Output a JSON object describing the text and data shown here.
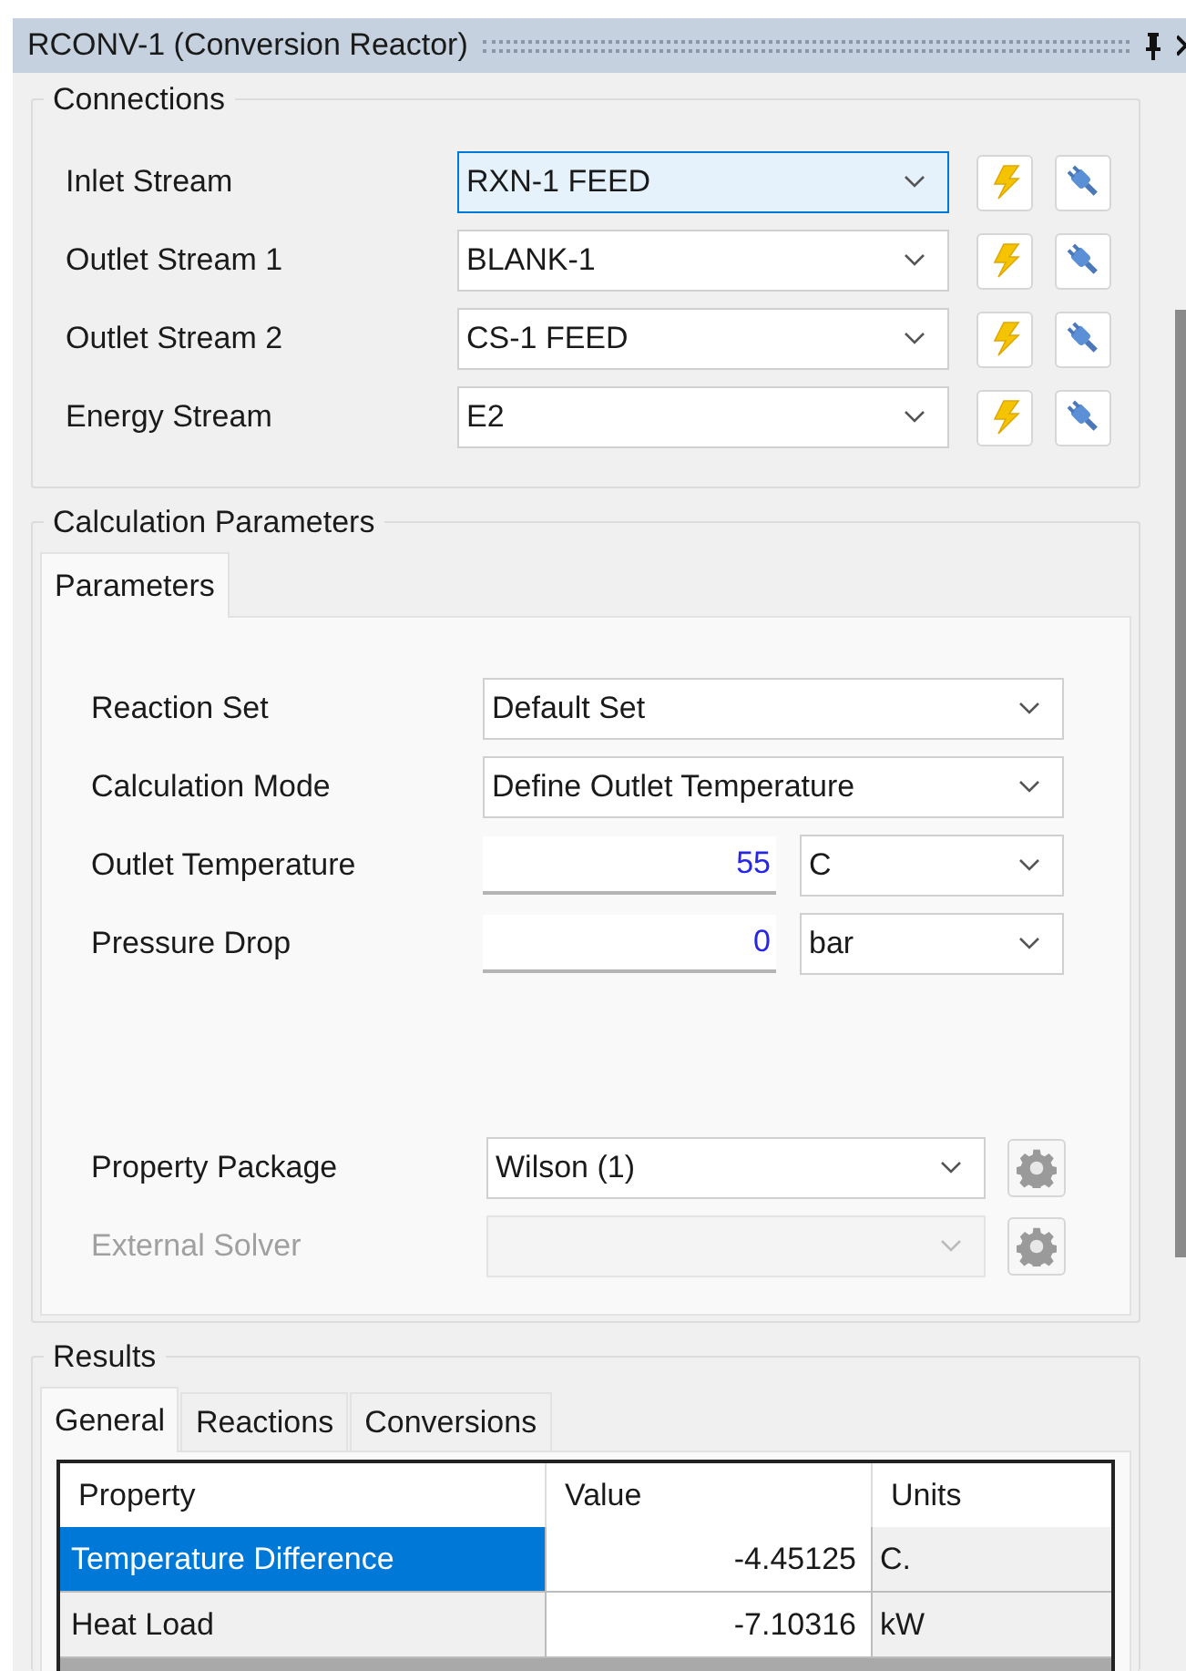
{
  "window": {
    "title": "RCONV-1 (Conversion Reactor)"
  },
  "connections": {
    "title": "Connections",
    "rows": [
      {
        "label": "Inlet Stream",
        "value": "RXN-1 FEED",
        "focused": true
      },
      {
        "label": "Outlet Stream 1",
        "value": "BLANK-1",
        "focused": false
      },
      {
        "label": "Outlet Stream 2",
        "value": "CS-1 FEED",
        "focused": false
      },
      {
        "label": "Energy Stream",
        "value": "E2",
        "focused": false
      }
    ]
  },
  "calculation_parameters": {
    "title": "Calculation Parameters",
    "tabs": [
      {
        "label": "Parameters",
        "selected": true
      }
    ],
    "rows": [
      {
        "kind": "combo",
        "label": "Reaction Set",
        "value": "Default Set"
      },
      {
        "kind": "combo",
        "label": "Calculation Mode",
        "value": "Define Outlet Temperature"
      },
      {
        "kind": "number",
        "label": "Outlet Temperature",
        "value": "55",
        "unit": "C"
      },
      {
        "kind": "number",
        "label": "Pressure Drop",
        "value": "0",
        "unit": "bar"
      }
    ],
    "packages": [
      {
        "label": "Property Package",
        "value": "Wilson (1)",
        "disabled": false
      },
      {
        "label": "External Solver",
        "disabled": true
      }
    ]
  },
  "results": {
    "title": "Results",
    "tabs": [
      {
        "label": "General",
        "selected": true
      },
      {
        "label": "Reactions",
        "selected": false
      },
      {
        "label": "Conversions",
        "selected": false
      }
    ],
    "table": {
      "columns": [
        "Property",
        "Value",
        "Units"
      ],
      "rows": [
        {
          "property": "Temperature Difference",
          "value": "-4.45125",
          "units": "C.",
          "selected": true
        },
        {
          "property": "Heat Load",
          "value": "-7.10316",
          "units": "kW",
          "selected": false
        }
      ]
    }
  }
}
